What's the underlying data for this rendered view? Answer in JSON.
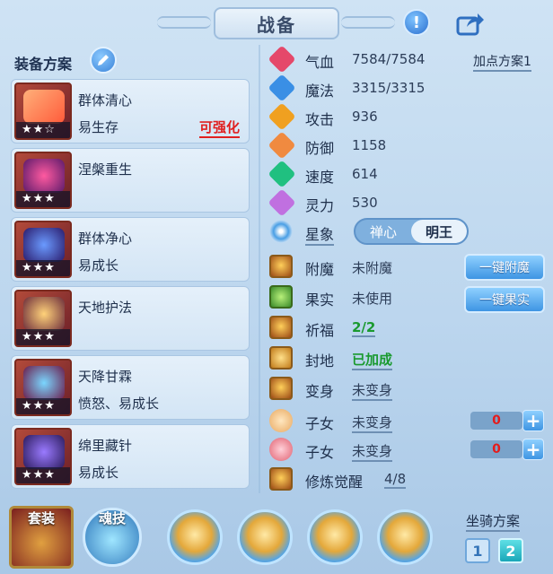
{
  "header": {
    "title": "战备"
  },
  "left": {
    "title": "装备方案",
    "equipment": [
      {
        "name": "群体清心",
        "attr": "易生存",
        "enhance": "可强化",
        "stars": "★★☆",
        "color": "#ff7a3a"
      },
      {
        "name": "涅槃重生",
        "attr": "",
        "enhance": "",
        "stars": "★★★",
        "color": "#c23a7a"
      },
      {
        "name": "群体净心",
        "attr": "易成长",
        "enhance": "",
        "stars": "★★★",
        "color": "#3a6fd8"
      },
      {
        "name": "天地护法",
        "attr": "",
        "enhance": "",
        "stars": "★★★",
        "color": "#d69a3a"
      },
      {
        "name": "天降甘霖",
        "attr": "愤怒、易成长",
        "enhance": "",
        "stars": "★★★",
        "color": "#3aa0d8"
      },
      {
        "name": "绵里藏针",
        "attr": "易成长",
        "enhance": "",
        "stars": "★★★",
        "color": "#5a4ad8"
      }
    ]
  },
  "stats": {
    "plan_label": "加点方案1",
    "rows": [
      {
        "label": "气血",
        "value": "7584/7584",
        "color": "#e5486a"
      },
      {
        "label": "魔法",
        "value": "3315/3315",
        "color": "#3a8fe5"
      },
      {
        "label": "攻击",
        "value": "936",
        "color": "#f0a020"
      },
      {
        "label": "防御",
        "value": "1158",
        "color": "#f08a40"
      },
      {
        "label": "速度",
        "value": "614",
        "color": "#20c080"
      },
      {
        "label": "灵力",
        "value": "530",
        "color": "#c070e0"
      }
    ],
    "star_label": "星象",
    "toggle": {
      "left": "禅心",
      "right": "明王"
    }
  },
  "buffs": [
    {
      "label": "附魔",
      "value": "未附魔"
    },
    {
      "label": "果实",
      "value": "未使用"
    },
    {
      "label": "祈福",
      "value": "2/2"
    },
    {
      "label": "封地",
      "value": "已加成"
    },
    {
      "label": "变身",
      "value": "未变身"
    }
  ],
  "buttons": {
    "enchant": "一键附魔",
    "fruit": "一键果实"
  },
  "children": [
    {
      "label": "子女",
      "value": "未变身",
      "count": "0"
    },
    {
      "label": "子女",
      "value": "未变身",
      "count": "0"
    }
  ],
  "cultivation": {
    "label": "修炼觉醒",
    "value": "4/8"
  },
  "bottom": {
    "suit": "套装",
    "skill": "魂技",
    "mount_title": "坐骑方案",
    "mount_1": "1",
    "mount_2": "2"
  }
}
